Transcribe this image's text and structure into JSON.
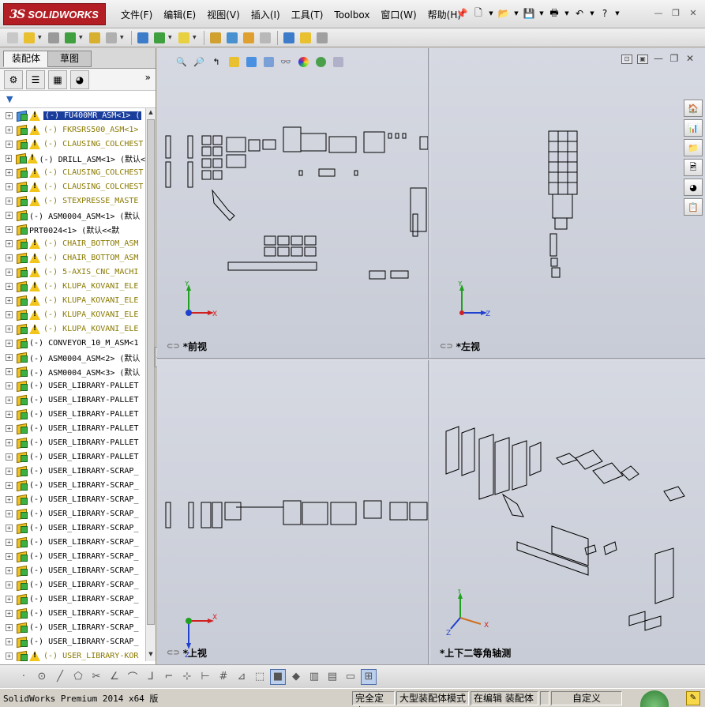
{
  "app": {
    "logo_ds": "3S",
    "logo_text": "SOLIDWORKS"
  },
  "menu": [
    "文件(F)",
    "编辑(E)",
    "视图(V)",
    "插入(I)",
    "工具(T)",
    "Toolbox",
    "窗口(W)",
    "帮助(H)"
  ],
  "tabs": {
    "assembly": "装配体",
    "sketch": "草图"
  },
  "tree": {
    "items": [
      {
        "label": "(-) FU400MR_ASM<1> (",
        "warn": true,
        "style": "sel",
        "blue": true
      },
      {
        "label": "(-) FKRSRS500_ASM<1>",
        "warn": true,
        "style": "olive"
      },
      {
        "label": "(-) CLAUSING_COLCHEST",
        "warn": true,
        "style": "olive"
      },
      {
        "label": "(-) DRILL_ASM<1> (默认<",
        "warn": true,
        "style": "normal"
      },
      {
        "label": "(-) CLAUSING_COLCHEST",
        "warn": true,
        "style": "olive"
      },
      {
        "label": "(-) CLAUSING_COLCHEST",
        "warn": true,
        "style": "olive"
      },
      {
        "label": "(-) STEXPRESSE_MASTE",
        "warn": true,
        "style": "olive"
      },
      {
        "label": "(-) ASM0004_ASM<1> (默认",
        "warn": false,
        "style": "normal"
      },
      {
        "label": "PRT0024<1> (默认<<默",
        "warn": false,
        "style": "normal"
      },
      {
        "label": "(-) CHAIR_BOTTOM_ASM",
        "warn": true,
        "style": "olive"
      },
      {
        "label": "(-) CHAIR_BOTTOM_ASM",
        "warn": true,
        "style": "olive"
      },
      {
        "label": "(-) 5-AXIS_CNC_MACHI",
        "warn": true,
        "style": "olive"
      },
      {
        "label": "(-) KLUPA_KOVANI_ELE",
        "warn": true,
        "style": "olive"
      },
      {
        "label": "(-) KLUPA_KOVANI_ELE",
        "warn": true,
        "style": "olive"
      },
      {
        "label": "(-) KLUPA_KOVANI_ELE",
        "warn": true,
        "style": "olive"
      },
      {
        "label": "(-) KLUPA_KOVANI_ELE",
        "warn": true,
        "style": "olive"
      },
      {
        "label": "(-) CONVEYOR_10_M_ASM<1",
        "warn": false,
        "style": "normal"
      },
      {
        "label": "(-) ASM0004_ASM<2> (默认",
        "warn": false,
        "style": "normal"
      },
      {
        "label": "(-) ASM0004_ASM<3> (默认",
        "warn": false,
        "style": "normal"
      },
      {
        "label": "(-) USER_LIBRARY-PALLET",
        "warn": false,
        "style": "normal"
      },
      {
        "label": "(-) USER_LIBRARY-PALLET",
        "warn": false,
        "style": "normal"
      },
      {
        "label": "(-) USER_LIBRARY-PALLET",
        "warn": false,
        "style": "normal"
      },
      {
        "label": "(-) USER_LIBRARY-PALLET",
        "warn": false,
        "style": "normal"
      },
      {
        "label": "(-) USER_LIBRARY-PALLET",
        "warn": false,
        "style": "normal"
      },
      {
        "label": "(-) USER_LIBRARY-PALLET",
        "warn": false,
        "style": "normal"
      },
      {
        "label": "(-) USER_LIBRARY-SCRAP_",
        "warn": false,
        "style": "normal"
      },
      {
        "label": "(-) USER_LIBRARY-SCRAP_",
        "warn": false,
        "style": "normal"
      },
      {
        "label": "(-) USER_LIBRARY-SCRAP_",
        "warn": false,
        "style": "normal"
      },
      {
        "label": "(-) USER_LIBRARY-SCRAP_",
        "warn": false,
        "style": "normal"
      },
      {
        "label": "(-) USER_LIBRARY-SCRAP_",
        "warn": false,
        "style": "normal"
      },
      {
        "label": "(-) USER_LIBRARY-SCRAP_",
        "warn": false,
        "style": "normal"
      },
      {
        "label": "(-) USER_LIBRARY-SCRAP_",
        "warn": false,
        "style": "normal"
      },
      {
        "label": "(-) USER_LIBRARY-SCRAP_",
        "warn": false,
        "style": "normal"
      },
      {
        "label": "(-) USER_LIBRARY-SCRAP_",
        "warn": false,
        "style": "normal"
      },
      {
        "label": "(-) USER_LIBRARY-SCRAP_",
        "warn": false,
        "style": "normal"
      },
      {
        "label": "(-) USER_LIBRARY-SCRAP_",
        "warn": false,
        "style": "normal"
      },
      {
        "label": "(-) USER_LIBRARY-SCRAP_",
        "warn": false,
        "style": "normal"
      },
      {
        "label": "(-) USER_LIBRARY-SCRAP_",
        "warn": false,
        "style": "normal"
      },
      {
        "label": "(-) USER_LIBRARY-KOR",
        "warn": true,
        "style": "olive"
      }
    ]
  },
  "viewports": {
    "front": {
      "label": "*前视",
      "axis_x": "X",
      "axis_y": "Y"
    },
    "left": {
      "label": "*左视",
      "axis_y": "Y",
      "axis_z": "Z"
    },
    "top": {
      "label": "*上视",
      "axis_x": "X",
      "axis_z": "Z"
    },
    "iso": {
      "label": "*上下二等角轴测",
      "axis_x": "X",
      "axis_y": "Y",
      "axis_z": "Z"
    }
  },
  "status": {
    "product": "SolidWorks Premium 2014 x64 版",
    "fully_defined": "完全定义",
    "large_assembly": "大型装配体模式",
    "editing": "在编辑 装配体",
    "custom": "自定义"
  },
  "colors": {
    "axis_x": "#d02020",
    "axis_y": "#20a020",
    "axis_z": "#2040d0",
    "selection": "#1a3d9c",
    "warning": "#f2c51a"
  }
}
